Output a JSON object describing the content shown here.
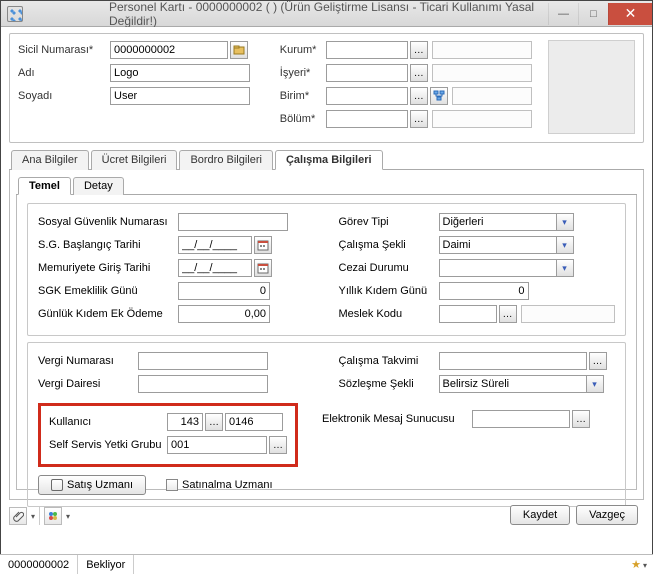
{
  "window": {
    "title": "Personel Kartı - 0000000002 ( ) (Ürün Geliştirme Lisansı - Ticari Kullanımı Yasal Değildir!)"
  },
  "header": {
    "left": {
      "sicil_label": "Sicil Numarası*",
      "sicil_value": "0000000002",
      "adi_label": "Adı",
      "adi_value": "Logo",
      "soyadi_label": "Soyadı",
      "soyadi_value": "User"
    },
    "right": {
      "kurum_label": "Kurum*",
      "isyeri_label": "İşyeri*",
      "birim_label": "Birim*",
      "bolum_label": "Bölüm*"
    }
  },
  "tabs": {
    "items": [
      "Ana Bilgiler",
      "Ücret Bilgileri",
      "Bordro Bilgileri",
      "Çalışma Bilgileri"
    ],
    "active": 3
  },
  "subtabs": {
    "items": [
      "Temel",
      "Detay"
    ],
    "active": 0
  },
  "temel": {
    "left": {
      "sosyal_guvenlik_label": "Sosyal Güvenlik Numarası",
      "sg_baslangic_label": "S.G. Başlangıç Tarihi",
      "sg_baslangic_value": "__/__/____",
      "memuriyet_label": "Memuriyete Giriş Tarihi",
      "memuriyet_value": "__/__/____",
      "sgk_emeklilik_label": "SGK Emeklilik Günü",
      "sgk_emeklilik_value": "0",
      "gunluk_kidem_label": "Günlük Kıdem Ek Ödeme",
      "gunluk_kidem_value": "0,00"
    },
    "right": {
      "gorev_tipi_label": "Görev Tipi",
      "gorev_tipi_value": "Diğerleri",
      "calisma_sekli_label": "Çalışma Şekli",
      "calisma_sekli_value": "Daimi",
      "cezai_durumu_label": "Cezai Durumu",
      "yillik_kidem_label": "Yıllık Kıdem Günü",
      "yillik_kidem_value": "0",
      "meslek_kodu_label": "Meslek Kodu"
    }
  },
  "vergi": {
    "vergi_numarasi_label": "Vergi Numarası",
    "vergi_dairesi_label": "Vergi Dairesi",
    "calisma_takvimi_label": "Çalışma Takvimi",
    "sozlesme_sekli_label": "Sözleşme Şekli",
    "sozlesme_sekli_value": "Belirsiz Süreli"
  },
  "kullanici": {
    "kullanici_label": "Kullanıcı",
    "kullanici_code": "143",
    "kullanici_value": "0146",
    "self_servis_label": "Self Servis Yetki Grubu",
    "self_servis_value": "001",
    "elektronik_label": "Elektronik Mesaj Sunucusu"
  },
  "checks": {
    "satis_uzmani": "Satış Uzmanı",
    "satinalma_uzmani": "Satınalma Uzmanı"
  },
  "buttons": {
    "kaydet": "Kaydet",
    "vazgec": "Vazgeç"
  },
  "status": {
    "id": "0000000002",
    "state": "Bekliyor"
  }
}
